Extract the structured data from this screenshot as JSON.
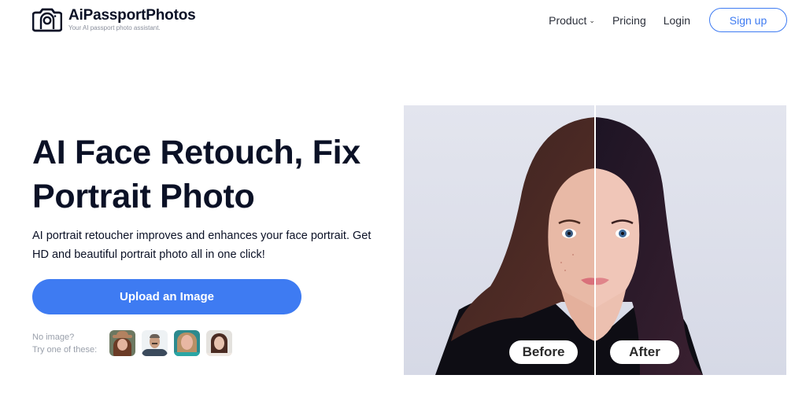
{
  "header": {
    "logo": {
      "icon": "camera-portrait-icon",
      "title": "AiPassportPhotos",
      "subtitle": "Your AI passport photo assistant."
    },
    "nav": {
      "product": "Product",
      "product_icon": "chevron-down-icon",
      "pricing": "Pricing",
      "login": "Login",
      "signup": "Sign up"
    }
  },
  "hero": {
    "title_line1": "AI Face Retouch, Fix",
    "title_line2": "Portrait Photo",
    "description": "AI portrait retoucher improves and enhances your face portrait. Get HD and beautiful portrait photo all in one click!",
    "upload_button": "Upload an Image",
    "sample_prompt_line1": "No image?",
    "sample_prompt_line2": "Try one of these:",
    "samples": [
      {
        "name": "woman-with-hat"
      },
      {
        "name": "man-with-mustache"
      },
      {
        "name": "blonde-woman"
      },
      {
        "name": "dark-haired-woman"
      }
    ]
  },
  "comparison": {
    "before_label": "Before",
    "after_label": "After"
  },
  "colors": {
    "accent": "#3e7bf2",
    "text_dark": "#0b1126",
    "muted": "#9aa0ab"
  }
}
